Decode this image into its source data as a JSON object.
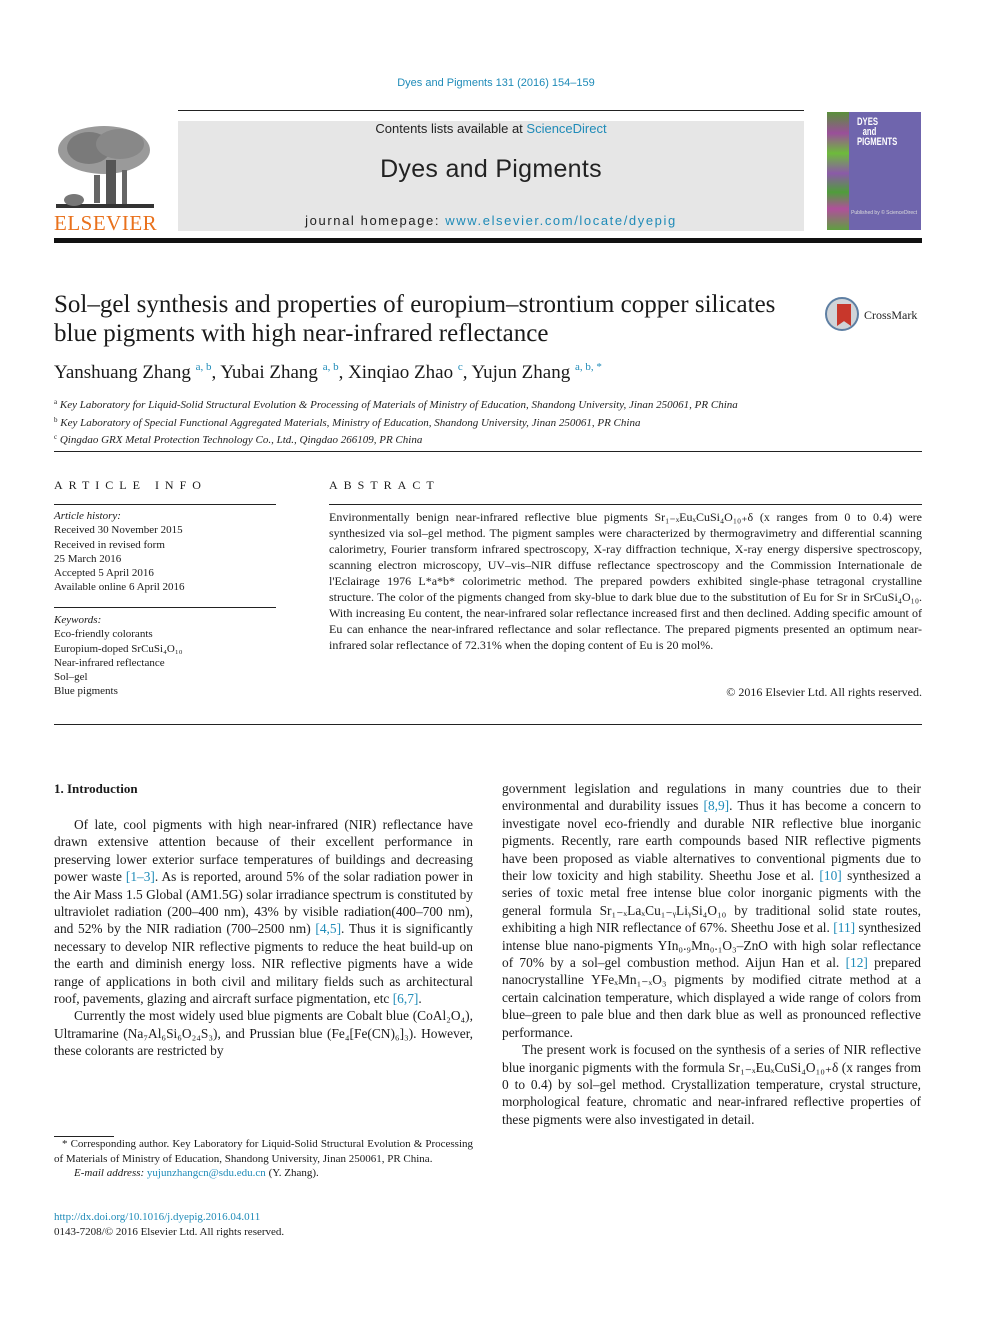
{
  "header": {
    "journal_ref": "Dyes and Pigments 131 (2016) 154–159",
    "contents_prefix": "Contents lists available at ",
    "contents_link": "ScienceDirect",
    "journal_title": "Dyes and Pigments",
    "homepage_prefix": "journal homepage: ",
    "homepage_link": "www.elsevier.com/locate/dyepig",
    "publisher": "ELSEVIER",
    "cover_title_lines": [
      "DYES",
      "and",
      "PIGMENTS"
    ],
    "cover_footer": "Published by © ScienceDirect"
  },
  "article": {
    "title": "Sol–gel synthesis and properties of europium–strontium copper silicates blue pigments with high near-infrared reflectance",
    "crossmark_label": "CrossMark",
    "authors": [
      {
        "name": "Yanshuang Zhang",
        "sup": "a, b"
      },
      {
        "name": "Yubai Zhang",
        "sup": "a, b"
      },
      {
        "name": "Xinqiao Zhao",
        "sup": "c"
      },
      {
        "name": "Yujun Zhang",
        "sup": "a, b, *"
      }
    ],
    "affiliations": [
      {
        "mark": "a",
        "text": "Key Laboratory for Liquid-Solid Structural Evolution & Processing of Materials of Ministry of Education, Shandong University, Jinan 250061, PR China"
      },
      {
        "mark": "b",
        "text": "Key Laboratory of Special Functional Aggregated Materials, Ministry of Education, Shandong University, Jinan 250061, PR China"
      },
      {
        "mark": "c",
        "text": "Qingdao GRX Metal Protection Technology Co., Ltd., Qingdao 266109, PR China"
      }
    ]
  },
  "article_info": {
    "heading": "ARTICLE INFO",
    "history_label": "Article history:",
    "history": [
      "Received 30 November 2015",
      "Received in revised form",
      "25 March 2016",
      "Accepted 5 April 2016",
      "Available online 6 April 2016"
    ],
    "keywords_label": "Keywords:",
    "keywords": [
      "Eco-friendly colorants",
      "Europium-doped SrCuSi₄O₁₀",
      "Near-infrared reflectance",
      "Sol–gel",
      "Blue pigments"
    ]
  },
  "abstract": {
    "heading": "ABSTRACT",
    "text": "Environmentally benign near-infrared reflective blue pigments Sr₁₋ₓEuₓCuSi₄O₁₀₊δ (x ranges from 0 to 0.4) were synthesized via sol–gel method. The pigment samples were characterized by thermogravimetry and differential scanning calorimetry, Fourier transform infrared spectroscopy, X-ray diffraction technique, X-ray energy dispersive spectroscopy, scanning electron microscopy, UV–vis–NIR diffuse reflectance spectroscopy and the Commission Internationale de l'Eclairage 1976 L*a*b* colorimetric method. The prepared powders exhibited single-phase tetragonal crystalline structure. The color of the pigments changed from sky-blue to dark blue due to the substitution of Eu for Sr in SrCuSi₄O₁₀. With increasing Eu content, the near-infrared solar reflectance increased first and then declined. Adding specific amount of Eu can enhance the near-infrared reflectance and solar reflectance. The prepared pigments presented an optimum near-infrared solar reflectance of 72.31% when the doping content of Eu is 20 mol%.",
    "copyright": "© 2016 Elsevier Ltd. All rights reserved."
  },
  "body": {
    "intro_heading": "1.  Introduction",
    "left_paragraphs": [
      {
        "parts": [
          {
            "t": "Of late, cool pigments with high near-infrared (NIR) reflectance have drawn extensive attention because of their excellent performance in preserving lower exterior surface temperatures of buildings and decreasing power waste "
          },
          {
            "ref": "[1–3]"
          },
          {
            "t": ". As is reported, around 5% of the solar radiation power in the Air Mass 1.5 Global (AM1.5G) solar irradiance spectrum is constituted by ultraviolet radiation (200–400 nm), 43% by visible radiation(400–700 nm), and 52% by the NIR radiation (700–2500 nm) "
          },
          {
            "ref": "[4,5]"
          },
          {
            "t": ". Thus it is significantly necessary to develop NIR reflective pigments to reduce the heat build-up on the earth and diminish energy loss. NIR reflective pigments have a wide range of applications in both civil and military fields such as architectural roof, pavements, glazing and aircraft surface pigmentation, etc "
          },
          {
            "ref": "[6,7]"
          },
          {
            "t": "."
          }
        ]
      },
      {
        "parts": [
          {
            "t": "Currently the most widely used blue pigments are Cobalt blue (CoAl₂O₄), Ultramarine (Na₇Al₆Si₆O₂₄S₃), and Prussian blue (Fe₄[Fe(CN)₆]₃). However, these colorants are restricted by"
          }
        ]
      }
    ],
    "right_paragraphs": [
      {
        "noindent": true,
        "parts": [
          {
            "t": "government legislation and regulations in many countries due to their environmental and durability issues "
          },
          {
            "ref": "[8,9]"
          },
          {
            "t": ". Thus it has become a concern to investigate novel eco-friendly and durable NIR reflective blue inorganic pigments. Recently, rare earth compounds based NIR reflective pigments have been proposed as viable alternatives to conventional pigments due to their low toxicity and high stability. Sheethu Jose et al. "
          },
          {
            "ref": "[10]"
          },
          {
            "t": " synthesized a series of toxic metal free intense blue color inorganic pigments with the general formula Sr₁₋ₓLaₓCu₁₋ᵧLiᵧSi₄O₁₀ by traditional solid state routes, exhibiting a high NIR reflectance of 67%. Sheethu Jose et al. "
          },
          {
            "ref": "[11]"
          },
          {
            "t": " synthesized intense blue nano-pigments YIn₀.₉Mn₀.₁O₃–ZnO with high solar reflectance of 70% by a sol–gel combustion method. Aijun Han et al. "
          },
          {
            "ref": "[12]"
          },
          {
            "t": " prepared nanocrystalline YFeₓMn₁₋ₓO₃ pigments by modified citrate method at a certain calcination temperature, which displayed a wide range of colors from blue–green to pale blue and then dark blue as well as pronounced reflective performance."
          }
        ]
      },
      {
        "parts": [
          {
            "t": "The present work is focused on the synthesis of a series of NIR reflective blue inorganic pigments with the formula Sr₁₋ₓEuₓCuSi₄O₁₀₊δ (x ranges from 0 to 0.4) by sol–gel method. Crystallization temperature, crystal structure, morphological feature, chromatic and near-infrared reflective properties of these pigments were also investigated in detail."
          }
        ]
      }
    ]
  },
  "footnote": {
    "corresponding": "* Corresponding author. Key Laboratory for Liquid-Solid Structural Evolution & Processing of Materials of Ministry of Education, Shandong University, Jinan 250061, PR China.",
    "email_label": "E-mail address: ",
    "email": "yujunzhangcn@sdu.edu.cn",
    "email_suffix": " (Y. Zhang)."
  },
  "doi": {
    "link": "http://dx.doi.org/10.1016/j.dyepig.2016.04.011",
    "issn_line": "0143-7208/© 2016 Elsevier Ltd. All rights reserved."
  },
  "colors": {
    "link": "#1f8bb8",
    "elsevier_orange": "#e9711c",
    "masthead_bg": "#e6e6e6",
    "cover_purple": "#6f65ad",
    "crossmark_red": "#c8372b"
  }
}
